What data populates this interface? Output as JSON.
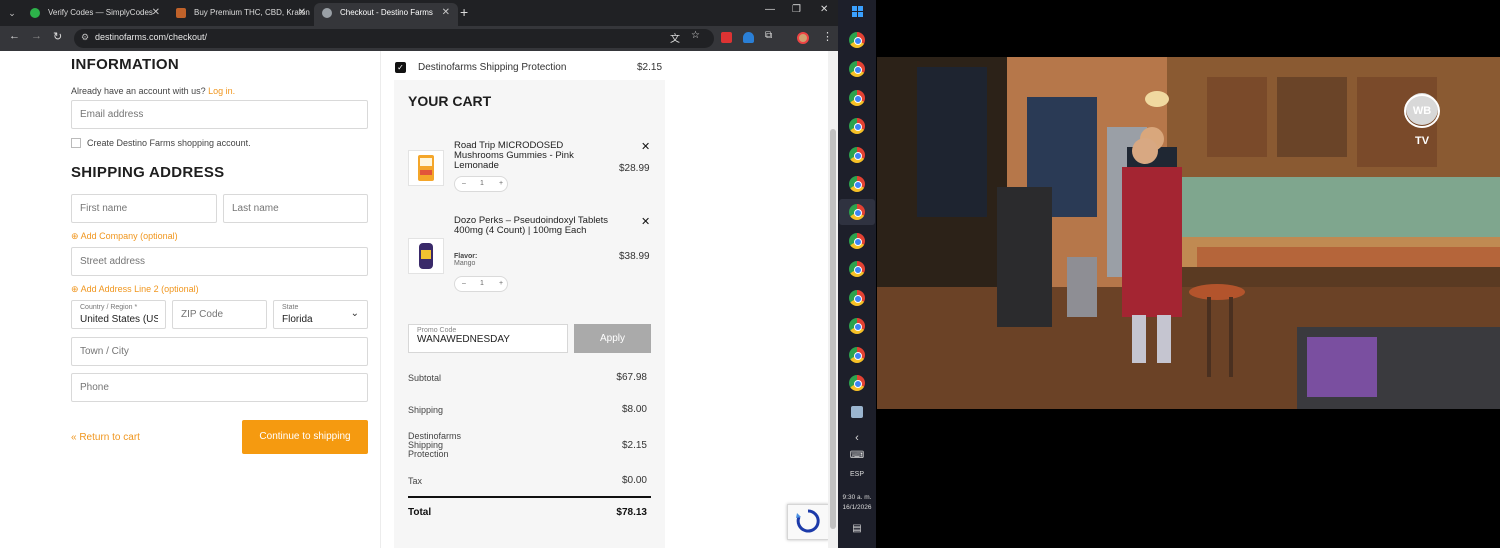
{
  "browser": {
    "tabs": [
      {
        "title": "Verify Codes — SimplyCodes",
        "favicon_color": "#2db24a"
      },
      {
        "title": "Buy Premium THC, CBD, Kraton",
        "favicon_color": "#c0622a"
      },
      {
        "title": "Checkout - Destino Farms",
        "favicon_color": "#9aa0a6",
        "active": true
      }
    ],
    "url": "destinofarms.com/checkout/"
  },
  "form": {
    "information_heading": "INFORMATION",
    "account_prompt": "Already have an account with us?",
    "login_link": "Log in.",
    "email_placeholder": "Email address",
    "create_account_label": "Create Destino Farms shopping account.",
    "shipping_heading": "SHIPPING ADDRESS",
    "first_name_placeholder": "First name",
    "last_name_placeholder": "Last name",
    "add_company": "Add Company (optional)",
    "street_placeholder": "Street address",
    "add_address_line2": "Add Address Line 2 (optional)",
    "country_label": "Country / Region *",
    "country_value": "United States (US)",
    "zip_placeholder": "ZIP Code",
    "state_label": "State",
    "state_value": "Florida",
    "town_placeholder": "Town / City",
    "phone_placeholder": "Phone",
    "return_link": "« Return to cart",
    "continue_button": "Continue to shipping"
  },
  "cart": {
    "shipping_protection_label": "Destinofarms Shipping Protection",
    "shipping_protection_price": "$2.15",
    "title": "YOUR CART",
    "items": [
      {
        "name": "Road Trip MICRODOSED Mushrooms Gummies - Pink Lemonade",
        "price": "$28.99",
        "qty": "1"
      },
      {
        "name": "Dozo Perks – Pseudoindoxyl Tablets 400mg (4 Count) | 100mg Each",
        "flavor_label": "Flavor:",
        "flavor_value": "Mango",
        "price": "$38.99",
        "qty": "1"
      }
    ],
    "promo_label": "Promo Code",
    "promo_value": "WANAWEDNESDAY",
    "apply_button": "Apply",
    "totals": {
      "subtotal_label": "Subtotal",
      "subtotal": "$67.98",
      "shipping_label": "Shipping",
      "shipping": "$8.00",
      "protection_label": "Destinofarms Shipping Protection",
      "protection": "$2.15",
      "tax_label": "Tax",
      "tax": "$0.00",
      "total_label": "Total",
      "total": "$78.13"
    }
  },
  "taskbar": {
    "language": "ESP",
    "time": "9:30 a. m.",
    "date": "16/1/2026"
  },
  "video": {
    "channel_logo": "WB TV"
  }
}
